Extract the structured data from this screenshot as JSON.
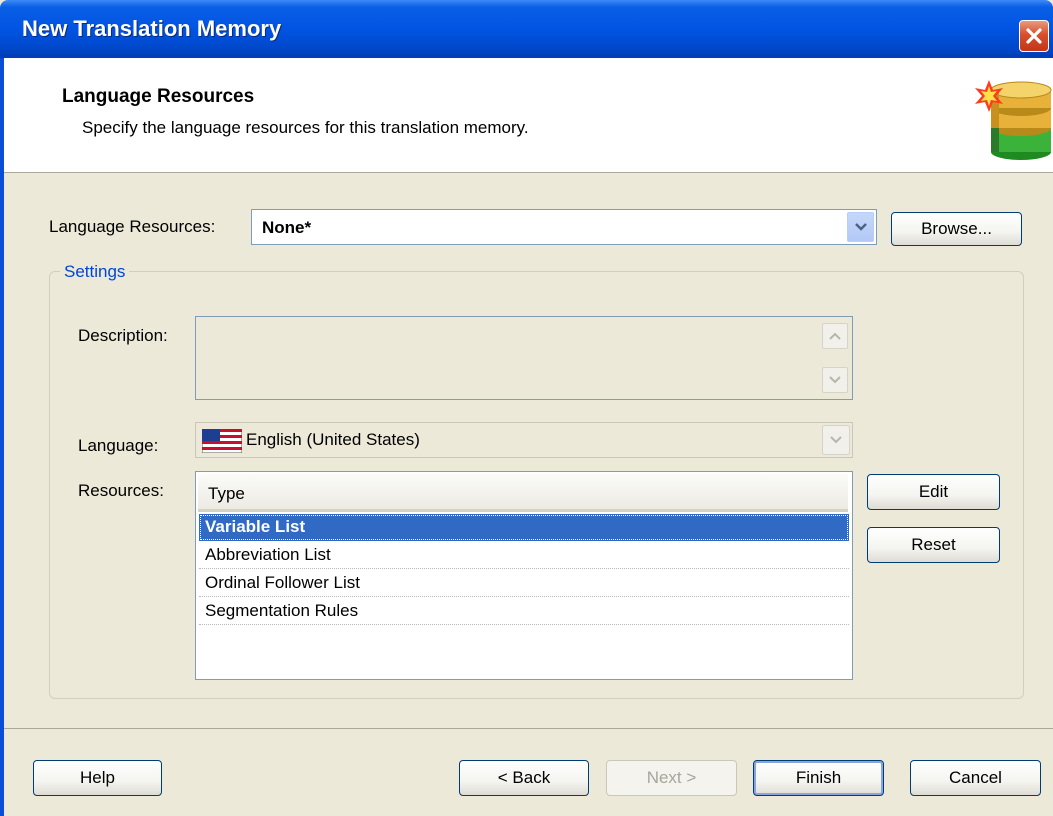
{
  "window": {
    "title": "New Translation Memory"
  },
  "header": {
    "title": "Language Resources",
    "subtitle": "Specify the language resources for this translation memory."
  },
  "language_resources": {
    "label": "Language Resources:",
    "value": "None*",
    "browse_label": "Browse..."
  },
  "settings": {
    "group_label": "Settings",
    "description_label": "Description:",
    "description_value": "",
    "language_label": "Language:",
    "language_value": "English (United States)",
    "resources_label": "Resources:",
    "resources_column": "Type",
    "resources": [
      {
        "label": "Variable List",
        "selected": true
      },
      {
        "label": "Abbreviation List",
        "selected": false
      },
      {
        "label": "Ordinal Follower List",
        "selected": false
      },
      {
        "label": "Segmentation Rules",
        "selected": false
      }
    ],
    "edit_label": "Edit",
    "reset_label": "Reset"
  },
  "footer": {
    "help": "Help",
    "back": "< Back",
    "next": "Next >",
    "finish": "Finish",
    "cancel": "Cancel"
  },
  "colors": {
    "titlebar": "#0054e3",
    "selection": "#316ac5",
    "dialog_bg": "#ece9d8"
  },
  "icons": [
    "close-icon",
    "database-icon",
    "dropdown-arrow-icon",
    "us-flag-icon",
    "scroll-up-icon",
    "scroll-down-icon"
  ]
}
